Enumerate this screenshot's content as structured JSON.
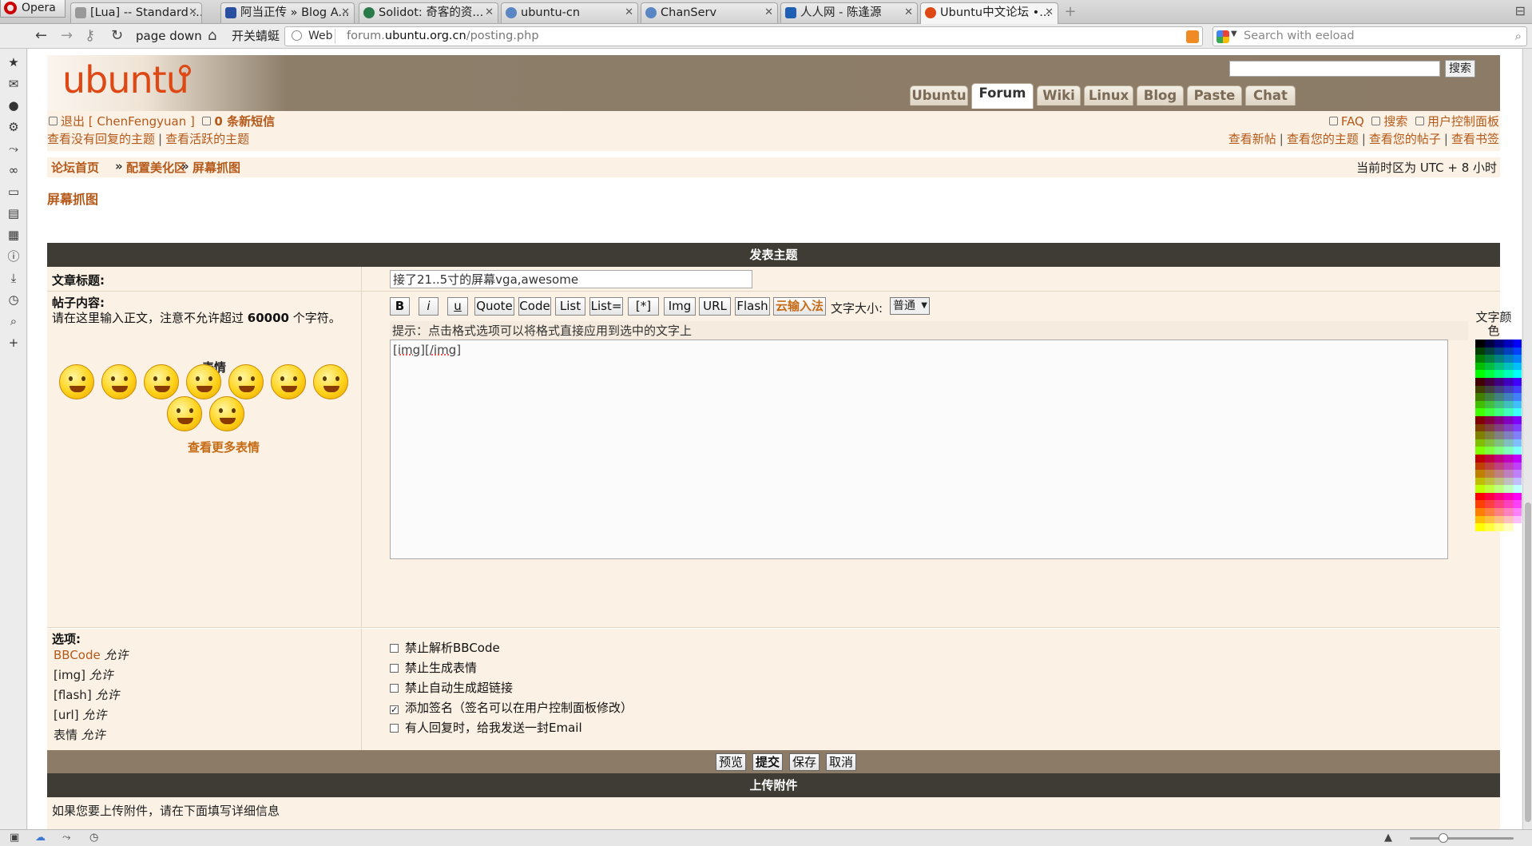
{
  "browser": {
    "menu_label": "Opera",
    "tabs": [
      {
        "title": "[Lua] -- Standard ...",
        "active": false
      },
      {
        "title": "阿当正传 » Blog A...",
        "active": false
      },
      {
        "title": "Solidot: 奇客的资...",
        "active": false
      },
      {
        "title": "ubuntu-cn",
        "active": false
      },
      {
        "title": "ChanServ",
        "active": false
      },
      {
        "title": "人人网 - 陈逢源",
        "active": false
      },
      {
        "title": "Ubuntu中文论坛 •...",
        "active": true
      }
    ],
    "toolbar": {
      "page_down": "page down",
      "bookmark1": "开关蜻蜓",
      "address_prefix": "Web",
      "url_prefix": "forum.",
      "url_domain": "ubuntu.org.cn",
      "url_path": "/posting.php",
      "search_placeholder": "Search with eeload"
    }
  },
  "site": {
    "logo": "ubuntu",
    "search_button": "搜索",
    "nav": [
      "Ubuntu",
      "Forum",
      "Wiki",
      "Linux",
      "Blog",
      "Paste",
      "Chat"
    ],
    "nav_active": "Forum",
    "user": {
      "logout": "退出 [ ChenFengyuan ]",
      "messages": "0 条新短信",
      "unanswered": "查看没有回复的主题",
      "active_topics": "查看活跃的主题",
      "faq": "FAQ",
      "search": "搜索",
      "ucp": "用户控制面板",
      "new_posts": "查看新帖",
      "your_topics": "查看您的主题",
      "your_posts": "查看您的帖子",
      "bookmarks": "查看书签"
    },
    "breadcrumb": [
      "论坛首页",
      "配置美化区",
      "屏幕抓图"
    ],
    "breadcrumb_sep": "»",
    "timezone": "当前时区为 UTC + 8 小时",
    "page_title": "屏幕抓图"
  },
  "form": {
    "header": "发表主题",
    "subject_label": "文章标题:",
    "subject_value": "接了21..5寸的屏幕vga,awesome",
    "body_label": "帖子内容:",
    "body_hint_pre": "请在这里输入正文，注意不允许超过 ",
    "body_hint_num": "60000",
    "body_hint_post": " 个字符。",
    "smilies_title": "表情",
    "smilies_more": "查看更多表情",
    "format_buttons": [
      "B",
      "i",
      "u",
      "Quote",
      "Code",
      "List",
      "List=",
      "[*]",
      "Img",
      "URL",
      "Flash",
      "云输入法"
    ],
    "font_size_label": "文字大小:",
    "font_size_value": "普通",
    "tip": "提示：点击格式选项可以将格式直接应用到选中的文字上",
    "body_text_a": "[img]",
    "body_text_b": "[/img]",
    "text_color_label": "文字颜色",
    "options_label": "选项:",
    "options_status": [
      {
        "name": "BBCode",
        "state": "允许"
      },
      {
        "name": "[img]",
        "state": "允许"
      },
      {
        "name": "[flash]",
        "state": "允许"
      },
      {
        "name": "[url]",
        "state": "允许"
      },
      {
        "name": "表情",
        "state": "允许"
      }
    ],
    "checkboxes": [
      {
        "label": "禁止解析BBCode",
        "checked": false
      },
      {
        "label": "禁止生成表情",
        "checked": false
      },
      {
        "label": "禁止自动生成超链接",
        "checked": false
      },
      {
        "label": "添加签名（签名可以在用户控制面板修改）",
        "checked": true
      },
      {
        "label": "有人回复时，给我发送一封Email",
        "checked": false
      }
    ],
    "buttons": {
      "preview": "预览",
      "submit": "提交",
      "save": "保存",
      "cancel": "取消"
    },
    "upload_header": "上传附件",
    "upload_hint": "如果您要上传附件，请在下面填写详细信息"
  },
  "colors": {
    "accent": "#b5591a",
    "header_dark": "#3f3c36",
    "row_bg": "#fbf1e4",
    "ubuntu_orange": "#dd4814"
  }
}
